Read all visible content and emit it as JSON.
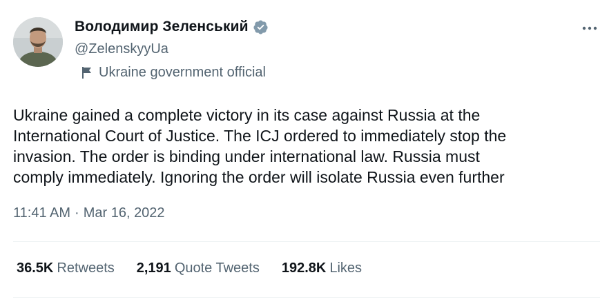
{
  "author": {
    "display_name": "Володимир Зеленський",
    "handle": "@ZelenskyyUa",
    "affiliation": "Ukraine government official",
    "avatar_icon": "avatar-photo",
    "verified_icon": "verified-badge-icon"
  },
  "tweet": {
    "text": "Ukraine gained a complete victory in its case against Russia at the\nInternational Court of Justice. The ICJ ordered to immediately stop the\ninvasion. The order is binding under international law.  Russia must\ncomply immediately. Ignoring the order will isolate Russia even further",
    "time": "11:41 AM",
    "separator": "·",
    "date": "Mar 16, 2022"
  },
  "stats": {
    "retweets": {
      "count": "36.5K",
      "label": "Retweets"
    },
    "quote_tweets": {
      "count": "2,191",
      "label": "Quote Tweets"
    },
    "likes": {
      "count": "192.8K",
      "label": "Likes"
    }
  },
  "colors": {
    "text_primary": "#0f1419",
    "text_secondary": "#536471",
    "verified": "#829aab",
    "divider": "#eff3f4"
  }
}
